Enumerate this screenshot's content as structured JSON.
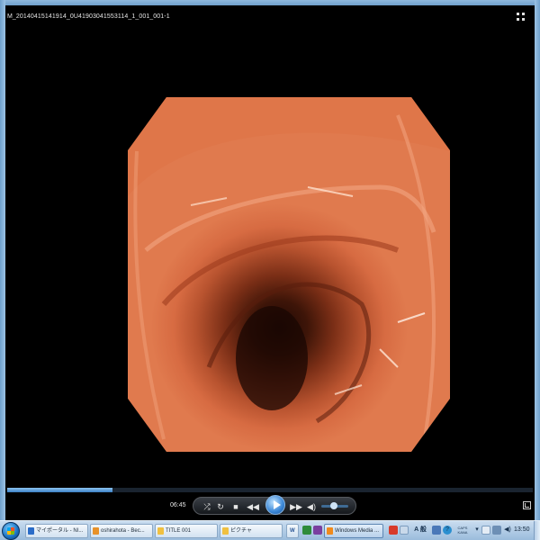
{
  "window": {
    "title": "M_20140415141914_0U41903041553114_1_001_001-1"
  },
  "player": {
    "elapsed": "06:45",
    "seek_progress": 0.2,
    "volume_level": 0.45
  },
  "controls": {
    "shuffle_icon": "shuffle-icon",
    "repeat_icon": "repeat-icon",
    "stop_icon": "stop-icon",
    "previous_icon": "previous-icon",
    "play_icon": "play-icon",
    "next_icon": "next-icon",
    "volume_icon": "speaker-icon"
  },
  "taskbar": {
    "tasks": [
      {
        "label": "マイポータル - NI...",
        "icon_color": "#2a6cc8"
      },
      {
        "label": "oshirahota - Bec...",
        "icon_color": "#e8922a"
      },
      {
        "label": "TITLE 001",
        "icon_color": "#f0c040"
      },
      {
        "label": "ピクチャ",
        "icon_color": "#f0c040"
      },
      {
        "label": "W",
        "icon_color": "#2b5797"
      },
      {
        "label": "Windows Media ...",
        "icon_color": "#f08a1c"
      }
    ],
    "tray": {
      "ime_text": "A 般",
      "caps_label": "CAPS",
      "kana_label": "KANA",
      "clock": "13:50"
    }
  },
  "colors": {
    "accent": "#3a86d6",
    "taskbar_bg": "#b6cfe8",
    "tissue": "#d76b42"
  }
}
